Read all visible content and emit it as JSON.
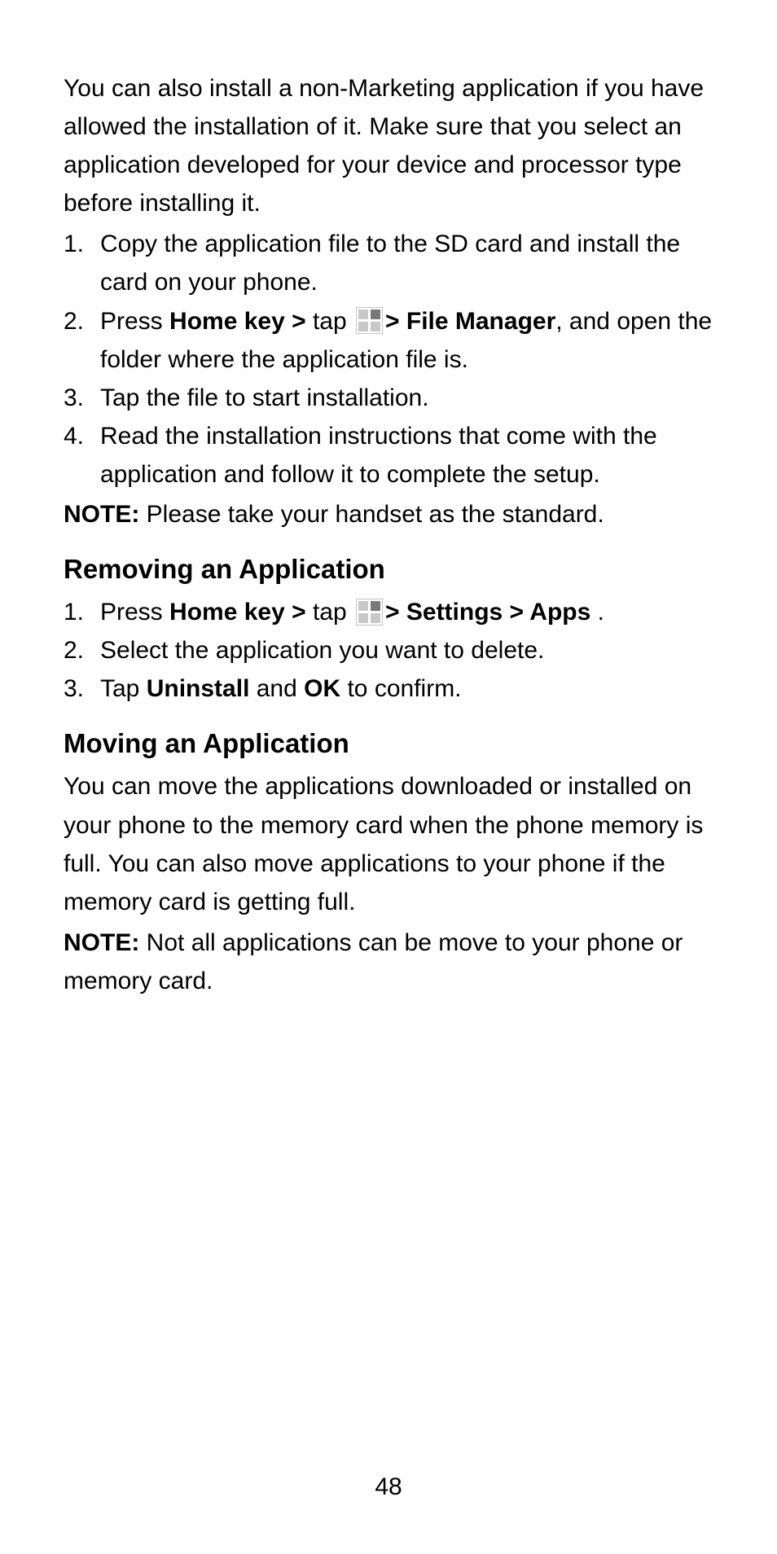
{
  "intro": "You can also install a non-Marketing application if you have allowed the installation of it. Make sure that you select an application developed for your device and processor type before installing it.",
  "install_list": {
    "item1": {
      "num": "1.",
      "text": "Copy the application file to the SD card and install the card on your phone."
    },
    "item2": {
      "num": "2.",
      "pre": "Press ",
      "bold1": "Home key > ",
      "mid": "tap ",
      "bold2": "> File Manager",
      "post": ", and open the folder where the application file is."
    },
    "item3": {
      "num": "3.",
      "text": "Tap the file to start installation."
    },
    "item4": {
      "num": "4.",
      "text": "Read the installation instructions that come with the application and follow it to complete the setup."
    }
  },
  "note1_label": "NOTE: ",
  "note1_text": "Please take your handset as the standard.",
  "heading_remove": "Removing an Application",
  "remove_list": {
    "item1": {
      "num": "1.",
      "pre": "Press ",
      "bold1": "Home key > ",
      "mid": "tap ",
      "bold2": "> Settings > Apps",
      "post": " ."
    },
    "item2": {
      "num": "2.",
      "text": "Select the application you want to delete."
    },
    "item3": {
      "num": "3.",
      "pre": "Tap ",
      "bold1": "Uninstall",
      "mid": " and ",
      "bold2": "OK",
      "post": " to confirm."
    }
  },
  "heading_move": "Moving an Application",
  "move_para": "You can move the applications downloaded or installed on your phone to the memory card when the phone memory is full. You can also move applications to your phone if the memory card is getting full.",
  "note2_label": "NOTE: ",
  "note2_text": "Not all applications can be move to your phone or memory card.",
  "page_number": "48"
}
